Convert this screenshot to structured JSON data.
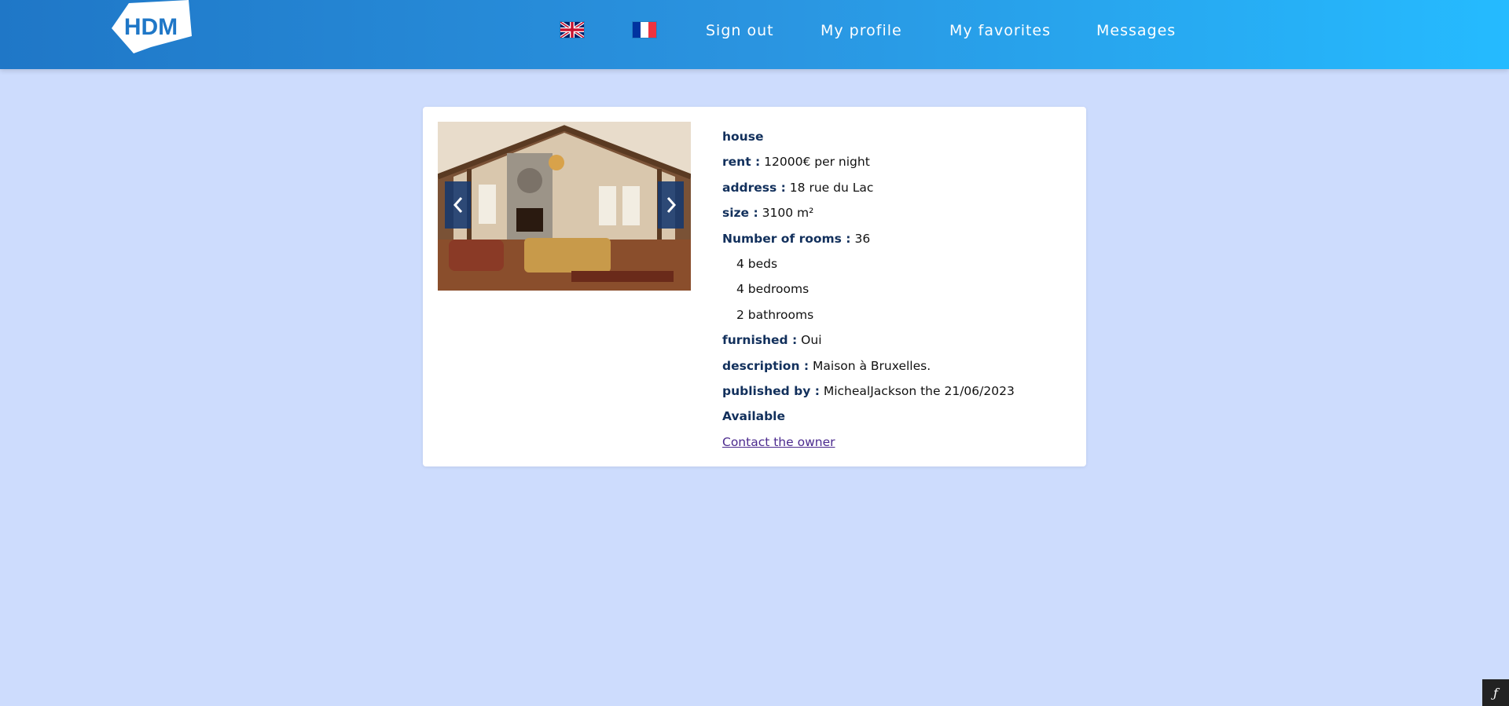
{
  "header": {
    "logo_text": "HDM",
    "flags": [
      {
        "icon": "uk-flag-icon",
        "language": "en"
      },
      {
        "icon": "france-flag-icon",
        "language": "fr"
      }
    ],
    "nav": {
      "sign_out": "Sign out",
      "my_profile": "My profile",
      "my_favorites": "My favorites",
      "messages": "Messages"
    }
  },
  "carousel": {
    "prev_label": "‹",
    "next_label": "›"
  },
  "listing": {
    "type": "house",
    "rent_label": "rent :",
    "rent_value": "12000€ per night",
    "address_label": "address :",
    "address_value": "18 rue du Lac",
    "size_label": "size :",
    "size_value": "3100 m²",
    "rooms_label": "Number of rooms :",
    "rooms_value": "36",
    "beds": "4 beds",
    "bedrooms": "4 bedrooms",
    "bathrooms": "2 bathrooms",
    "furnished_label": "furnished :",
    "furnished_value": "Oui",
    "description_label": "description :",
    "description_value": "Maison à Bruxelles.",
    "published_label": "published by :",
    "published_value": "MichealJackson the 21/06/2023",
    "availability": "Available",
    "contact_link": "Contact the owner"
  },
  "debug_toolbar": {
    "icon": "symfony-icon",
    "glyph": "ƒ"
  },
  "colors": {
    "header_gradient_start": "#1f77c7",
    "header_gradient_end": "#25bbff",
    "page_background": "#cddcfd",
    "label_color": "#12305c",
    "link_color": "#4b2a8e"
  }
}
